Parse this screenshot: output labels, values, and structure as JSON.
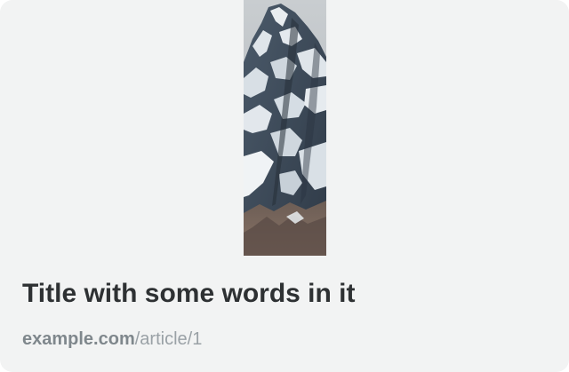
{
  "card": {
    "title": "Title with some words in it",
    "link": {
      "domain": "example.com",
      "path": "/article/1"
    }
  },
  "colors": {
    "card_background": "#f2f3f3",
    "title_text": "#2e3133",
    "url_text": "#8a9196"
  }
}
